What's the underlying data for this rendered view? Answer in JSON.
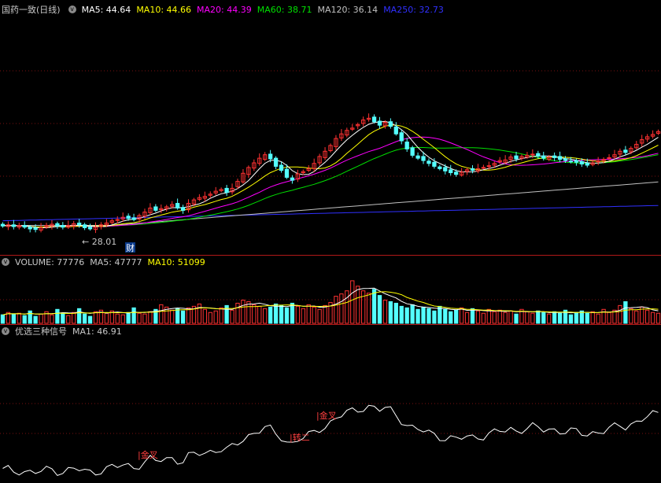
{
  "main": {
    "stock_title": "国药一致(日线)",
    "ma": [
      {
        "label": "MA5: 44.64",
        "color": "#ffffff"
      },
      {
        "label": "MA10: 44.66",
        "color": "#ffff00"
      },
      {
        "label": "MA20: 44.39",
        "color": "#ff00ff"
      },
      {
        "label": "MA60: 38.71",
        "color": "#00e000"
      },
      {
        "label": "MA120: 36.14",
        "color": "#c0c0c0"
      },
      {
        "label": "MA250: 32.73",
        "color": "#3030ff"
      }
    ],
    "low_label": "28.01",
    "event_marker": "财"
  },
  "volume": {
    "title": "VOLUME: 77776",
    "ma5": "MA5: 47777",
    "ma10": "MA10: 51099"
  },
  "indicator": {
    "title": "优选三种信号",
    "ma1": "MA1: 46.91",
    "signals": [
      "金叉",
      "转二",
      "金叉"
    ]
  },
  "colors": {
    "up": "#ff3232",
    "down": "#54ffff",
    "grid": "#7a1010",
    "sep": "#b01818"
  },
  "series": {
    "closes": [
      28.5,
      28.7,
      28.4,
      28.6,
      28.3,
      28.0,
      27.9,
      28.2,
      28.6,
      28.8,
      28.5,
      28.3,
      28.6,
      28.9,
      28.7,
      28.2,
      28.0,
      28.3,
      28.7,
      29.0,
      29.4,
      29.6,
      30.0,
      29.8,
      29.6,
      30.3,
      30.9,
      31.6,
      31.2,
      31.5,
      31.8,
      32.2,
      31.6,
      31.2,
      32.4,
      33.0,
      33.4,
      33.6,
      34.0,
      34.5,
      34.8,
      34.3,
      35.0,
      36.2,
      37.6,
      38.6,
      39.4,
      40.2,
      40.8,
      40.1,
      38.8,
      38.1,
      36.9,
      36.4,
      37.5,
      37.9,
      38.4,
      39.3,
      40.5,
      41.4,
      42.4,
      43.6,
      44.4,
      45.0,
      45.4,
      46.0,
      46.8,
      47.1,
      46.5,
      45.9,
      46.4,
      45.7,
      44.4,
      43.2,
      41.8,
      40.7,
      40.2,
      39.8,
      39.3,
      38.8,
      38.4,
      38.0,
      37.7,
      37.4,
      37.8,
      38.2,
      38.1,
      38.4,
      38.6,
      38.9,
      39.3,
      39.8,
      39.9,
      40.4,
      40.1,
      40.5,
      40.7,
      40.9,
      40.6,
      40.2,
      40.4,
      40.3,
      40.0,
      39.8,
      39.6,
      39.5,
      39.2,
      39.0,
      39.4,
      39.7,
      40.0,
      40.3,
      40.8,
      41.4,
      41.2,
      41.9,
      42.6,
      43.4,
      43.9,
      44.3,
      44.8
    ],
    "opens": [
      28.8,
      28.4,
      28.7,
      28.3,
      28.6,
      28.3,
      28.2,
      27.8,
      28.3,
      28.5,
      28.9,
      28.6,
      28.3,
      28.5,
      29.0,
      28.7,
      28.3,
      27.9,
      28.4,
      28.7,
      29.1,
      29.5,
      29.7,
      30.2,
      29.9,
      29.7,
      30.2,
      30.8,
      31.8,
      31.3,
      31.5,
      31.9,
      32.4,
      31.7,
      31.3,
      32.3,
      33.1,
      33.3,
      33.8,
      34.2,
      34.6,
      35.0,
      34.4,
      35.3,
      36.1,
      37.4,
      38.5,
      39.3,
      40.0,
      40.9,
      40.2,
      39.0,
      38.3,
      36.8,
      36.6,
      37.7,
      38.1,
      38.4,
      39.4,
      40.3,
      41.5,
      42.2,
      43.7,
      44.2,
      45.2,
      45.8,
      46.2,
      46.9,
      47.3,
      46.6,
      45.8,
      46.5,
      45.6,
      44.6,
      43.0,
      42.0,
      40.6,
      40.5,
      39.7,
      39.5,
      38.7,
      38.6,
      38.2,
      37.8,
      37.3,
      37.9,
      38.4,
      38.0,
      38.6,
      38.8,
      39.0,
      39.6,
      39.5,
      40.0,
      40.6,
      40.2,
      40.4,
      40.8,
      41.0,
      40.6,
      40.0,
      40.6,
      40.5,
      40.1,
      39.7,
      39.8,
      39.6,
      39.3,
      39.1,
      39.6,
      39.8,
      40.2,
      40.4,
      40.9,
      41.6,
      41.3,
      42.0,
      42.8,
      43.5,
      44.0,
      44.5
    ],
    "volumes": [
      11,
      14,
      12,
      13,
      10,
      16,
      9,
      12,
      15,
      11,
      18,
      13,
      10,
      14,
      19,
      12,
      9,
      15,
      17,
      13,
      16,
      12,
      11,
      14,
      20,
      13,
      12,
      15,
      18,
      24,
      21,
      17,
      19,
      16,
      20,
      22,
      25,
      18,
      14,
      16,
      20,
      23,
      17,
      26,
      30,
      28,
      24,
      22,
      19,
      21,
      25,
      23,
      20,
      26,
      22,
      19,
      24,
      21,
      18,
      23,
      27,
      35,
      38,
      42,
      55,
      48,
      42,
      39,
      44,
      36,
      30,
      28,
      26,
      22,
      20,
      24,
      18,
      21,
      19,
      16,
      22,
      18,
      15,
      17,
      20,
      14,
      19,
      16,
      13,
      18,
      15,
      17,
      14,
      16,
      12,
      18,
      15,
      13,
      16,
      14,
      12,
      15,
      13,
      17,
      11,
      14,
      16,
      13,
      15,
      12,
      18,
      14,
      17,
      23,
      28,
      19,
      16,
      21,
      17,
      14,
      13
    ]
  }
}
